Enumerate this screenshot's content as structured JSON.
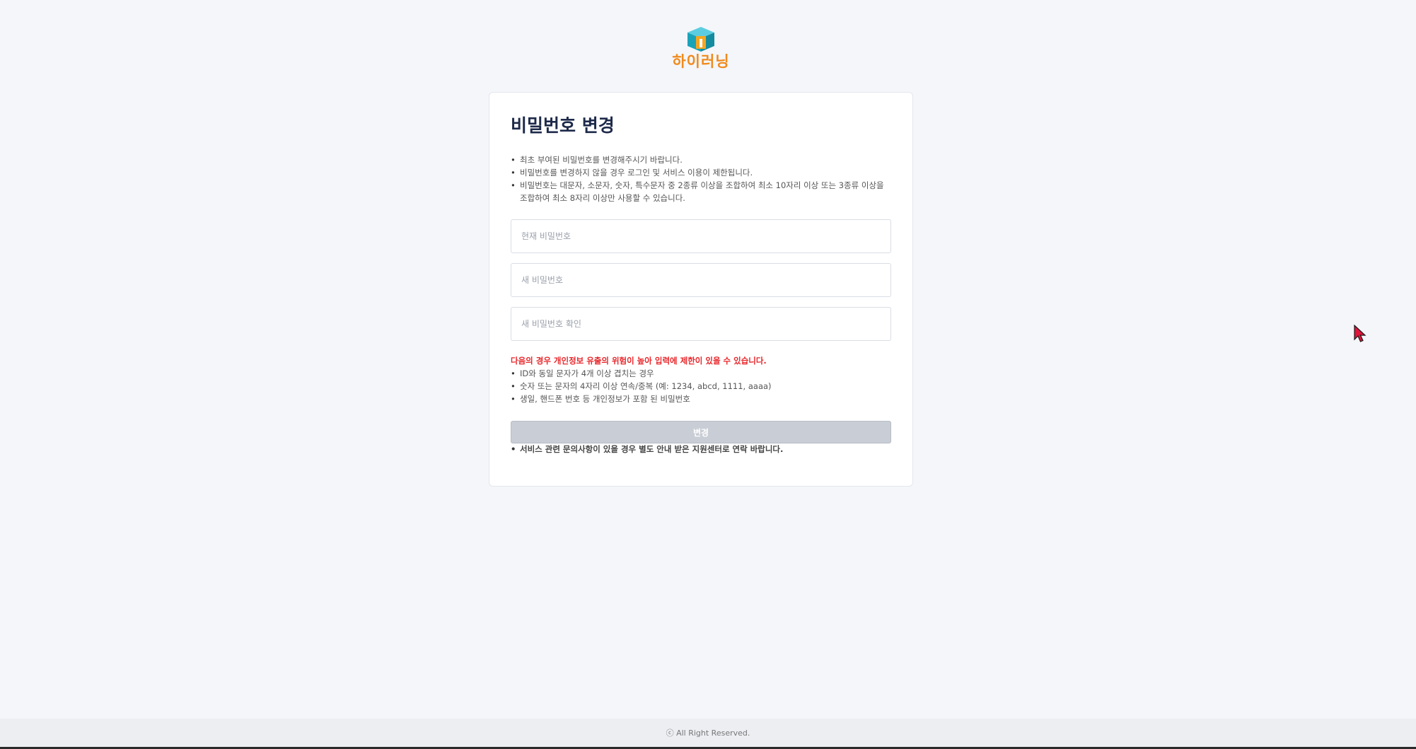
{
  "brand": {
    "logo_text": "하이러닝",
    "icon": "hi-learning-cube-logo",
    "primary_color": "#f08a1c",
    "icon_color": "#1aa3b8"
  },
  "page": {
    "title": "비밀번호 변경"
  },
  "notices": [
    "최초 부여된 비밀번호를 변경해주시기 바랍니다.",
    "비밀번호를 변경하지 않을 경우 로그인 및 서비스 이용이 제한됩니다.",
    "비밀번호는 대문자, 소문자, 숫자, 특수문자 중 2종류 이상을 조합하여 최소 10자리 이상 또는 3종류 이상을 조합하여 최소 8자리 이상만 사용할 수 있습니다."
  ],
  "form": {
    "current_password_placeholder": "현재 비밀번호",
    "new_password_placeholder": "새 비밀번호",
    "confirm_password_placeholder": "새 비밀번호 확인"
  },
  "warning": {
    "title": "다음의 경우 개인정보 유출의 위험이 높아 입력에 제한이 있을 수 있습니다.",
    "color": "#e8262a",
    "items": [
      "ID와 동일 문자가 4개 이상 겹치는 경우",
      "숫자 또는 문자의 4자리 이상 연속/중복 (예: 1234, abcd, 1111, aaaa)",
      "생일, 핸드폰 번호 등 개인정보가 포함 된 비밀번호"
    ]
  },
  "submit": {
    "label": "변경",
    "disabled_color": "#c9cdd5"
  },
  "contact_notice": "서비스 관련 문의사항이 있을 경우 별도 안내 받은 지원센터로 연락 바랍니다.",
  "footer": {
    "copyright": "ⓒ All Right Reserved."
  }
}
